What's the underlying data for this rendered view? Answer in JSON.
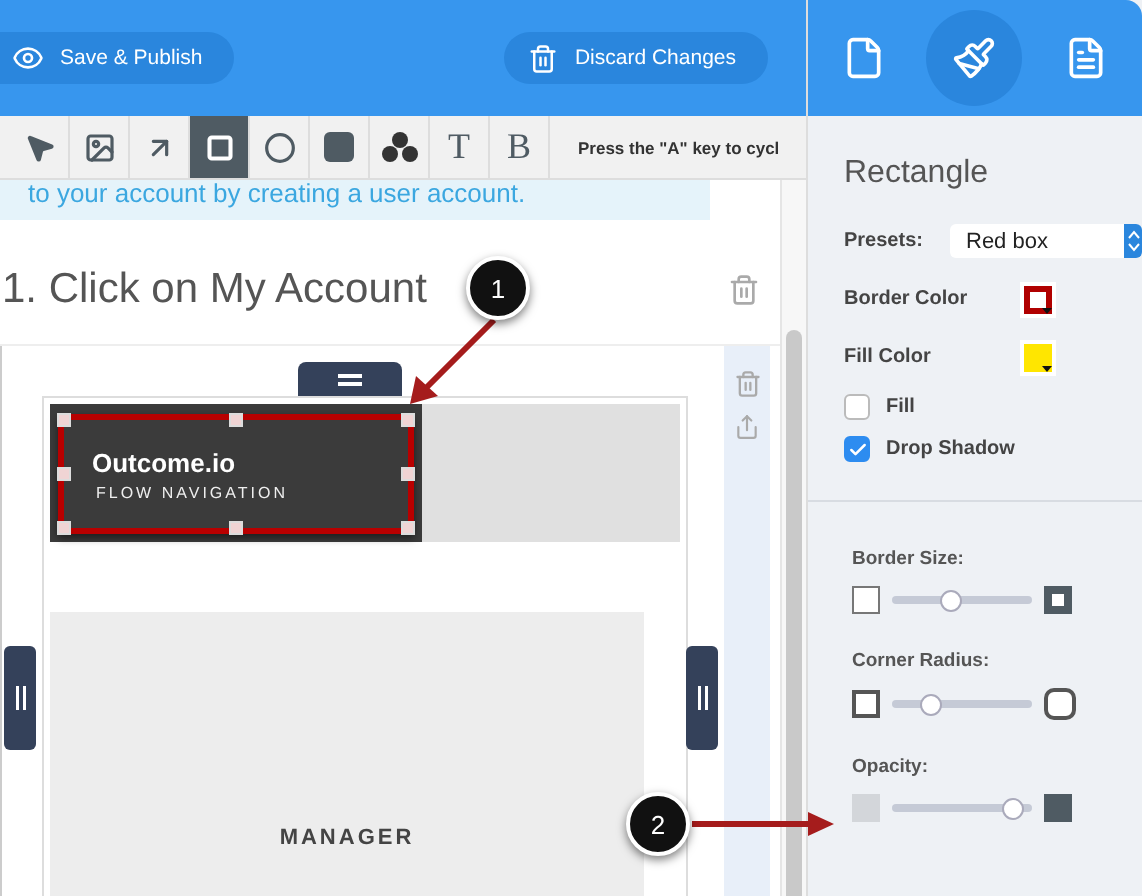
{
  "header": {
    "buttons": [
      {
        "kind": "publish",
        "label": "Save & Publish"
      },
      {
        "kind": "discard",
        "label": "Discard Changes"
      }
    ]
  },
  "toolbar": {
    "tools": [
      {
        "kind": "pointer",
        "selected": false
      },
      {
        "kind": "image",
        "selected": false
      },
      {
        "kind": "arrow",
        "selected": false
      },
      {
        "kind": "rectangle",
        "selected": true
      },
      {
        "kind": "ellipse",
        "selected": false
      },
      {
        "kind": "filled",
        "selected": false
      },
      {
        "kind": "numbers",
        "selected": false
      },
      {
        "kind": "text",
        "label": "T",
        "selected": false
      },
      {
        "kind": "text",
        "label": "B",
        "selected": false
      }
    ],
    "hint": "Press the \"A\" key to cycl"
  },
  "banner": "to your account by creating a user account.",
  "step_title": "1. Click on My Account",
  "preview": {
    "logo": "Outcome.io",
    "subtitle": "FLOW NAVIGATION",
    "section": "MANAGER"
  },
  "annotations": [
    {
      "label": "1"
    },
    {
      "label": "2"
    }
  ],
  "panel": {
    "tabs": [
      {
        "kind": "page",
        "selected": false
      },
      {
        "kind": "style",
        "selected": true
      },
      {
        "kind": "document",
        "selected": false
      }
    ],
    "title": "Rectangle",
    "presets": {
      "label": "Presets:",
      "value": "Red box"
    },
    "colors": [
      {
        "label": "Border Color",
        "kind": "border",
        "color": "#b00000"
      },
      {
        "label": "Fill Color",
        "kind": "fill",
        "color": "#ffe600"
      }
    ],
    "options": [
      {
        "label": "Fill",
        "checked": false
      },
      {
        "label": "Drop Shadow",
        "checked": true
      }
    ],
    "sliders": [
      {
        "label": "Border Size:",
        "kind": "border",
        "level": 0.4
      },
      {
        "label": "Corner Radius:",
        "kind": "radius",
        "level": 0.23
      },
      {
        "label": "Opacity:",
        "kind": "opacity",
        "level": 0.93
      }
    ]
  }
}
